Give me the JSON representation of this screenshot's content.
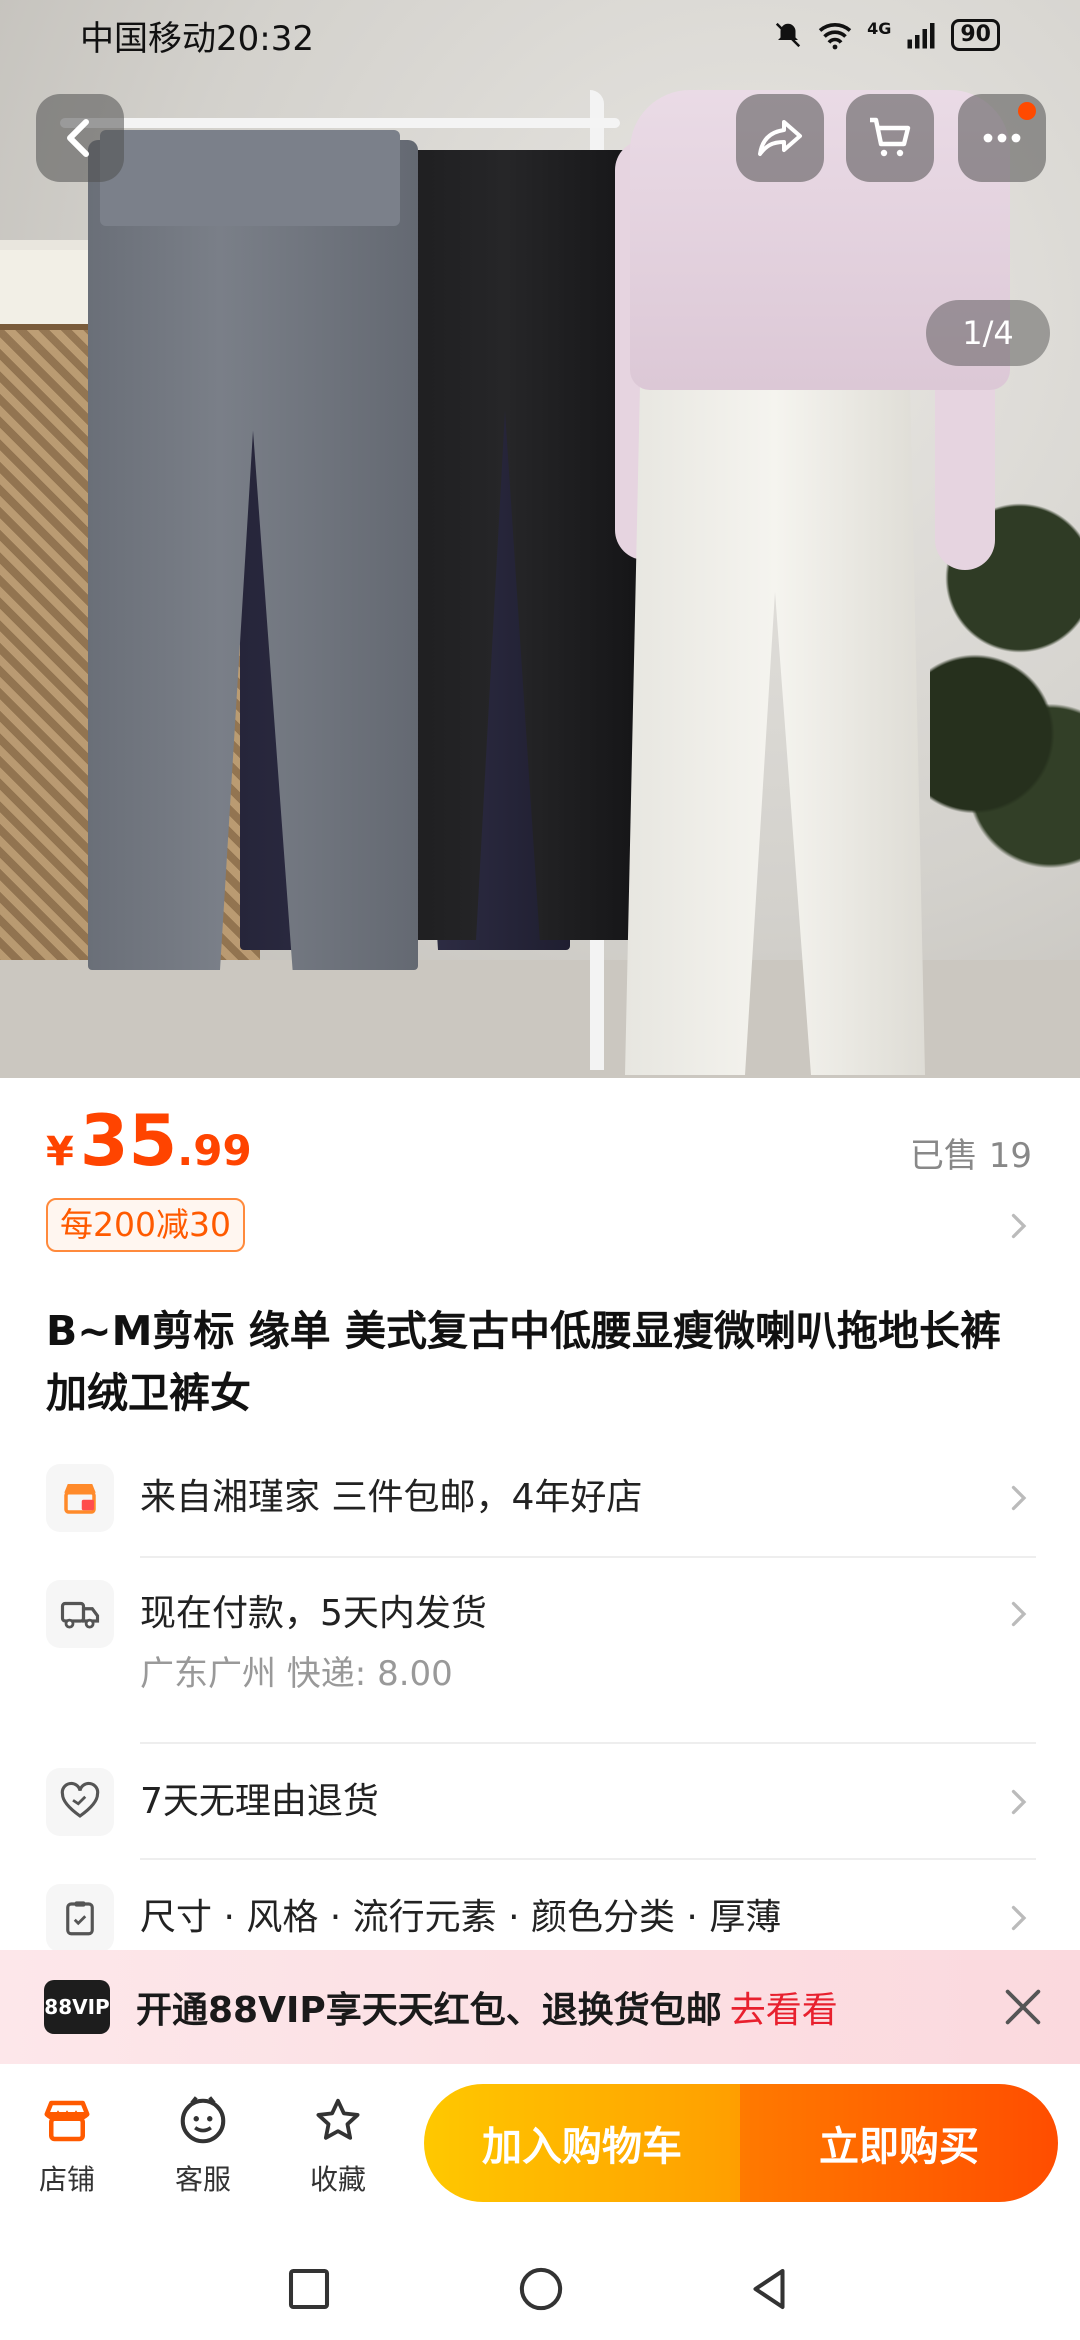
{
  "status_bar": {
    "carrier_time": "中国移动20:32",
    "network": "4G",
    "battery": "90",
    "icons": [
      "mute-bell-icon",
      "wifi-icon",
      "signal-icon",
      "battery-icon"
    ]
  },
  "gallery": {
    "counter": "1/4",
    "has_notification_dot": true
  },
  "price": {
    "currency": "¥",
    "integer": "35",
    "decimal": ".99",
    "sold": "已售 19",
    "color": "#ff4400"
  },
  "coupon": "每200减30",
  "product_title": "B~M剪标 缘单 美式复古中低腰显瘦微喇叭拖地长裤加绒卫裤女",
  "info_rows": [
    {
      "icon": "shop-icon",
      "text": "来自湘瑾家 三件包邮，4年好店"
    },
    {
      "icon": "truck-icon",
      "text": "现在付款，5天内发货",
      "sub": "广东广州  快递: 8.00"
    },
    {
      "icon": "heart-return-icon",
      "text": "7天无理由退货"
    },
    {
      "icon": "clipboard-icon",
      "text": "尺寸 · 风格 · 流行元素 · 颜色分类 · 厚薄"
    }
  ],
  "vip_banner": {
    "badge": "88VIP",
    "text": "开通88VIP享天天红包、退换货包邮",
    "link": "去看看"
  },
  "bottom_bar": {
    "shop": "店铺",
    "service": "客服",
    "favorite": "收藏",
    "add_to_cart": "加入购物车",
    "buy_now": "立即购买"
  },
  "colors": {
    "accent_orange": "#ff5a00",
    "cart_yellow": "#ffb400",
    "buy_orange": "#ff5a00",
    "vip_link": "#e8202e"
  }
}
